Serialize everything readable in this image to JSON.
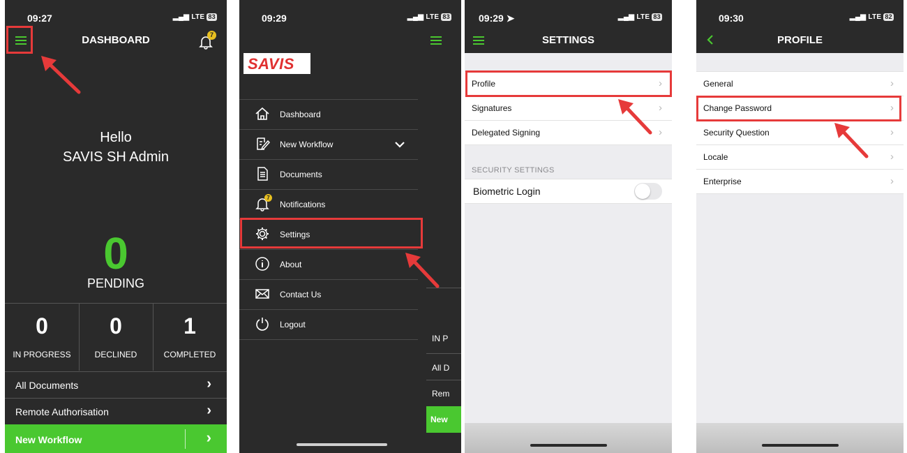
{
  "phone1": {
    "time": "09:27",
    "signal": "LTE",
    "battery": "83",
    "title": "DASHBOARD",
    "notif_count": "7",
    "greeting": "Hello",
    "user": "SAVIS SH Admin",
    "pending_count": "0",
    "pending_label": "PENDING",
    "stats": [
      {
        "value": "0",
        "label": "IN PROGRESS"
      },
      {
        "value": "0",
        "label": "DECLINED"
      },
      {
        "value": "1",
        "label": "COMPLETED"
      }
    ],
    "rows": [
      "All Documents",
      "Remote Authorisation"
    ],
    "new_workflow": "New Workflow"
  },
  "phone2": {
    "time": "09:29",
    "signal": "LTE",
    "battery": "83",
    "logo": "SAVIS",
    "notif_count": "7",
    "menu": [
      "Dashboard",
      "New Workflow",
      "Documents",
      "Notifications",
      "Settings",
      "About",
      "Contact Us",
      "Logout"
    ],
    "behind": [
      "IN P",
      "All D",
      "Rem",
      "New"
    ]
  },
  "phone3": {
    "time": "09:29",
    "signal": "LTE",
    "battery": "83",
    "title": "SETTINGS",
    "rows": [
      "Profile",
      "Signatures",
      "Delegated Signing"
    ],
    "section": "SECURITY SETTINGS",
    "biometric": "Biometric Login"
  },
  "phone4": {
    "time": "09:30",
    "signal": "LTE",
    "battery": "82",
    "title": "PROFILE",
    "rows": [
      "General",
      "Change Password",
      "Security Question",
      "Locale",
      "Enterprise"
    ]
  },
  "colors": {
    "accent": "#4ac830",
    "highlight": "#e63a3a",
    "dark": "#2a2a2a"
  }
}
